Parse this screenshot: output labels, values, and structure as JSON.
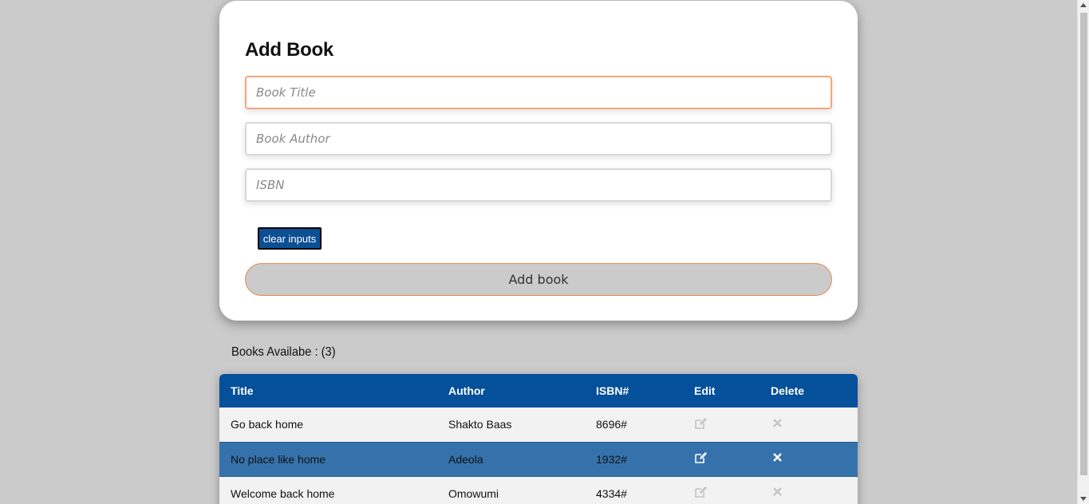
{
  "form": {
    "title": "Add Book",
    "title_placeholder": "Book Title",
    "author_placeholder": "Book Author",
    "isbn_placeholder": "ISBN",
    "clear_label": "clear inputs",
    "add_label": "Add book"
  },
  "books": {
    "count_label": "Books Availabe : (3)",
    "headers": {
      "title": "Title",
      "author": "Author",
      "isbn": "ISBN#",
      "edit": "Edit",
      "delete": "Delete"
    },
    "rows": [
      {
        "title": "Go back home",
        "author": "Shakto Baas",
        "isbn": "8696#"
      },
      {
        "title": "No place like home",
        "author": "Adeola",
        "isbn": "1932#"
      },
      {
        "title": "Welcome back home",
        "author": "Omowumi",
        "isbn": "4334#"
      }
    ]
  },
  "icons": {
    "edit": "edit-icon",
    "delete": "close-icon"
  },
  "colors": {
    "header_blue": "#04509a",
    "selected_row": "#3572ab",
    "accent_orange": "#e88a55"
  }
}
